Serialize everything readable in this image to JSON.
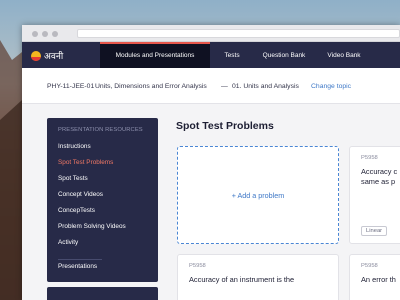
{
  "app": {
    "logo_text": "अवनी"
  },
  "nav": {
    "items": [
      {
        "label": "Modules and Presentations",
        "active": true
      },
      {
        "label": "Tests",
        "active": false
      },
      {
        "label": "Question Bank",
        "active": false
      },
      {
        "label": "Video Bank",
        "active": false
      }
    ]
  },
  "breadcrumb": {
    "course_code": "PHY-11-JEE-01",
    "chapter": "Units, Dimensions and Error Analysis",
    "separator": "—",
    "topic": "01. Units and Analysis",
    "change_topic": "Change topic"
  },
  "sidebar": {
    "heading": "PRESENTATION RESOURCES",
    "items": [
      {
        "label": "Instructions",
        "active": false
      },
      {
        "label": "Spot Test Problems",
        "active": true
      },
      {
        "label": "Spot Tests",
        "active": false
      },
      {
        "label": "Concept Videos",
        "active": false
      },
      {
        "label": "ConcepTests",
        "active": false
      },
      {
        "label": "Problem Solving Videos",
        "active": false
      },
      {
        "label": "Activity",
        "active": false
      }
    ],
    "footer_item": "Presentations"
  },
  "main": {
    "title": "Spot Test Problems",
    "add_problem": "+ Add a problem",
    "cards": [
      {
        "id": "P5958",
        "text_lines": [
          "Accuracy c",
          "same as p"
        ],
        "tag": "Linear"
      },
      {
        "id": "P5958",
        "text_lines": [
          "Accuracy of an instrument is the"
        ],
        "tag": ""
      },
      {
        "id": "P5958",
        "text_lines": [
          "An error th"
        ],
        "tag": ""
      }
    ]
  },
  "colors": {
    "nav_bg": "#272a48",
    "nav_active_bg": "#0f1122",
    "accent_red": "#e6574c",
    "link_blue": "#3e78c7"
  }
}
